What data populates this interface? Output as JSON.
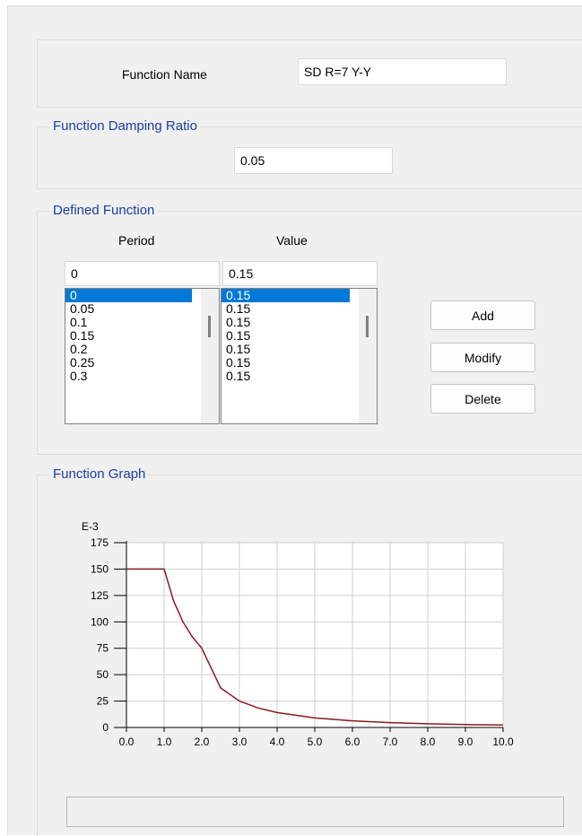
{
  "function_name": {
    "label": "Function Name",
    "value": "SD R=7 Y-Y"
  },
  "damping": {
    "group_title": "Function Damping Ratio",
    "value": "0.05"
  },
  "defined_function": {
    "group_title": "Defined Function",
    "period_header": "Period",
    "value_header": "Value",
    "period_input": "0",
    "value_input": "0.15",
    "periods": [
      "0",
      "0.05",
      "0.1",
      "0.15",
      "0.2",
      "0.25",
      "0.3"
    ],
    "values": [
      "0.15",
      "0.15",
      "0.15",
      "0.15",
      "0.15",
      "0.15",
      "0.15"
    ],
    "selected_index": 0,
    "add_label": "Add",
    "modify_label": "Modify",
    "delete_label": "Delete"
  },
  "graph": {
    "group_title": "Function Graph"
  },
  "chart_data": {
    "type": "line",
    "y_exponent_label": "E-3",
    "xlim": [
      0,
      10
    ],
    "ylim": [
      0,
      175
    ],
    "x_ticks": [
      "0.0",
      "1.0",
      "2.0",
      "3.0",
      "4.0",
      "5.0",
      "6.0",
      "7.0",
      "8.0",
      "9.0",
      "10.0"
    ],
    "y_ticks": [
      "0",
      "25",
      "50",
      "75",
      "100",
      "125",
      "150",
      "175"
    ],
    "grid": true,
    "line_color": "#8b1a1a",
    "x": [
      0,
      1.0,
      1.25,
      1.5,
      1.75,
      2.0,
      2.5,
      3.0,
      3.5,
      4.0,
      5.0,
      6.0,
      7.0,
      8.0,
      9.0,
      10.0
    ],
    "y": [
      150,
      150,
      120,
      100,
      85.7,
      75,
      37.5,
      25,
      18.4,
      14.1,
      9.0,
      6.3,
      4.6,
      3.5,
      2.8,
      2.3
    ]
  }
}
